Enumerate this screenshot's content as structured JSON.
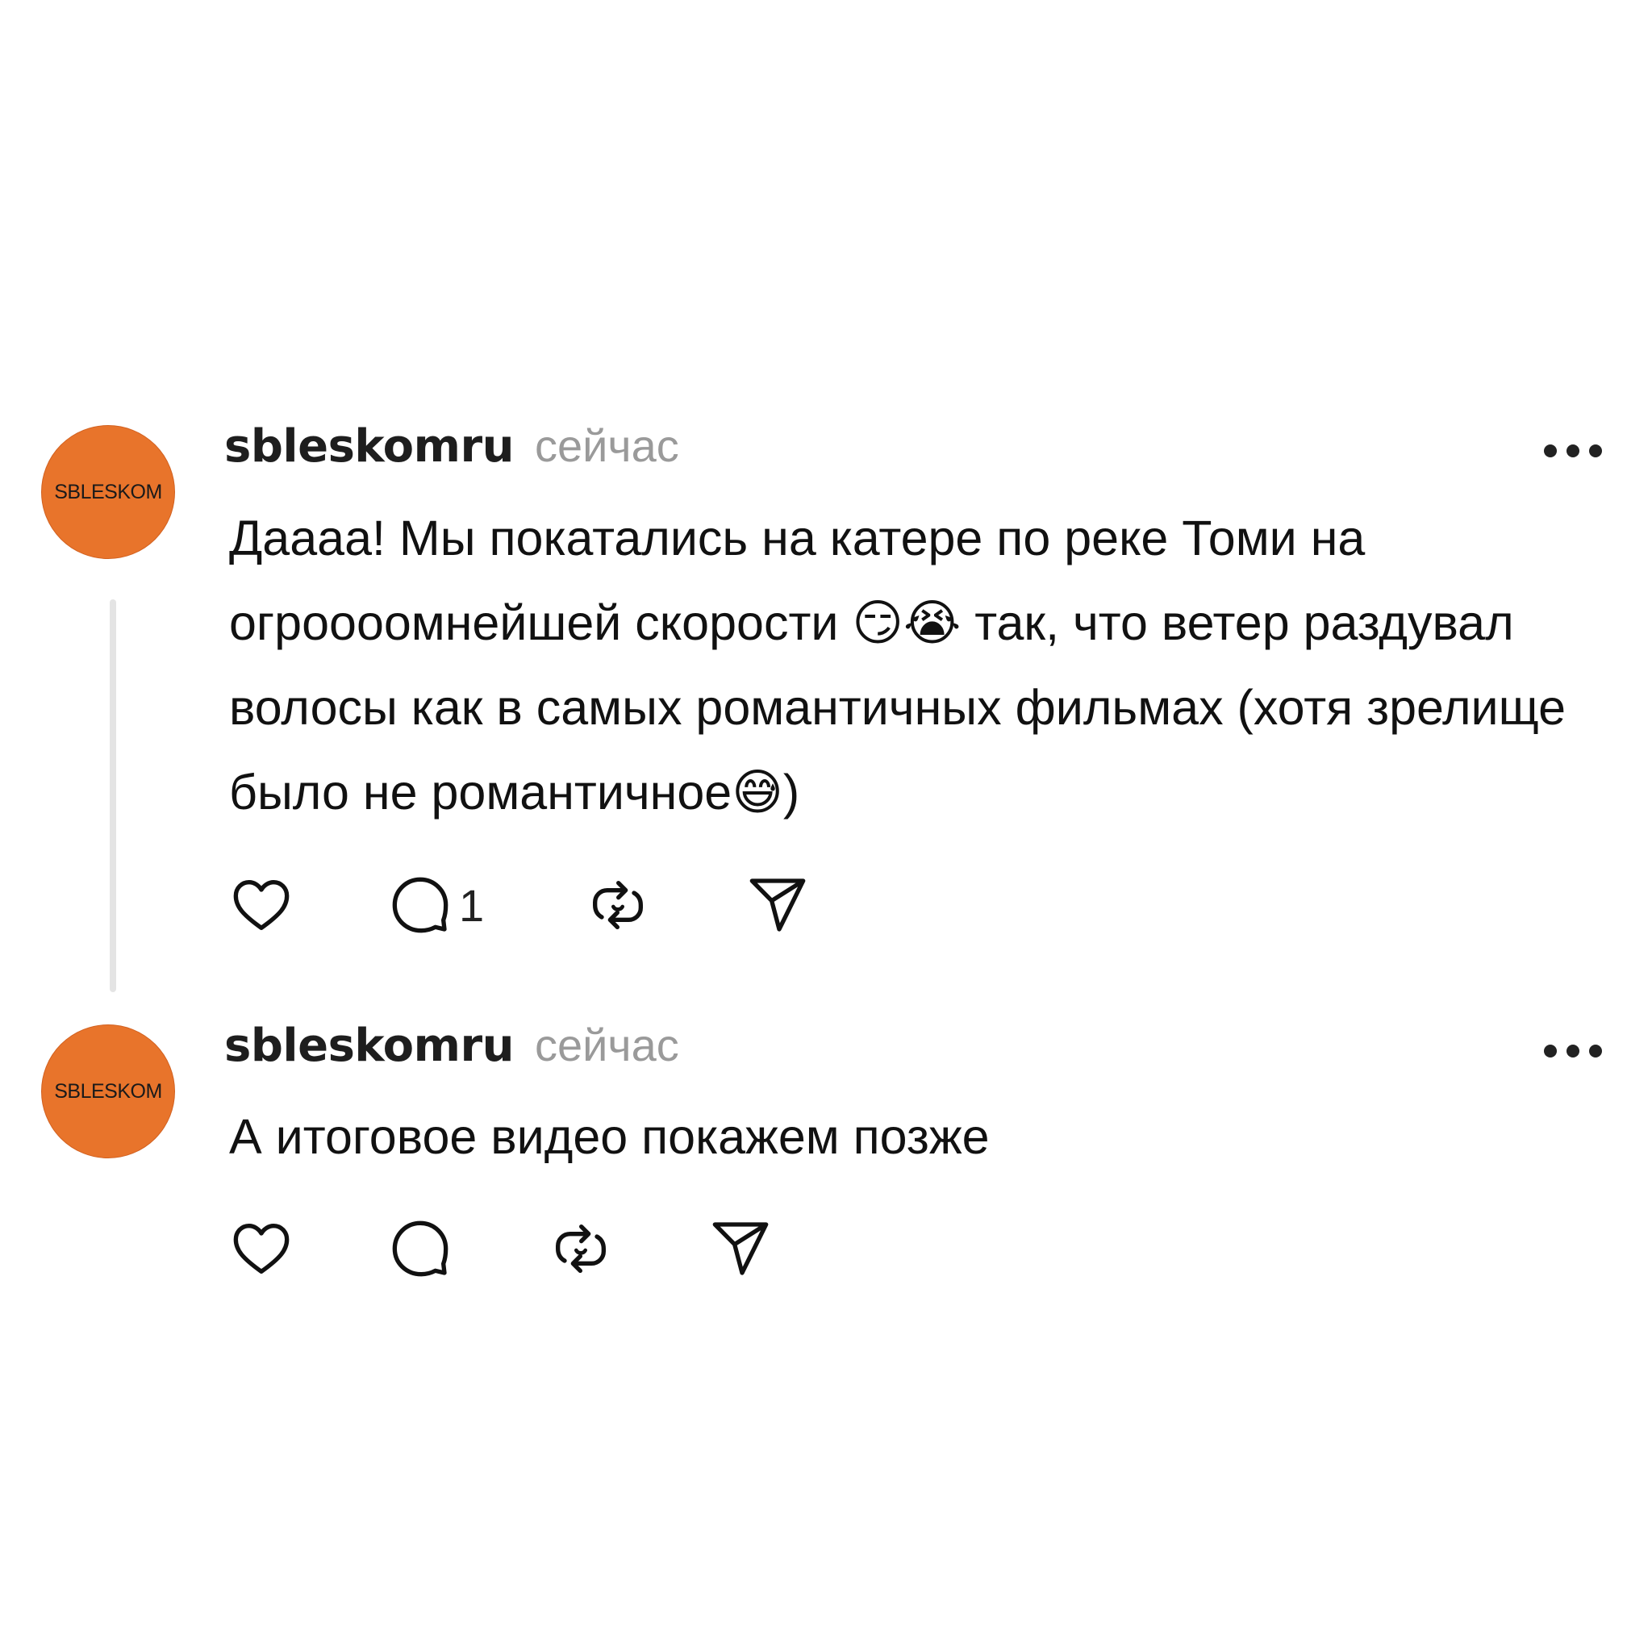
{
  "posts": [
    {
      "avatar_text": "SBLESKOM",
      "username": "sbleskomru",
      "time": "сейчас",
      "text": "Даааа! Мы покатались на катере по реке Томи на огроооомнейшей скорости 😏😭 так, что ветер раздувал волосы как в самых романтичных фильмах (хотя зрелище было не романтичное😅)",
      "reply_count": "1"
    },
    {
      "avatar_text": "SBLESKOM",
      "username": "sbleskomru",
      "time": "сейчас",
      "text": "А итоговое видео покажем позже",
      "reply_count": ""
    }
  ],
  "colors": {
    "avatar": "#e8742b",
    "thread_line": "#e4e4e4",
    "muted": "#9a9a9a"
  },
  "icons": [
    "more-icon",
    "heart-icon",
    "comment-icon",
    "repost-icon",
    "share-icon"
  ]
}
